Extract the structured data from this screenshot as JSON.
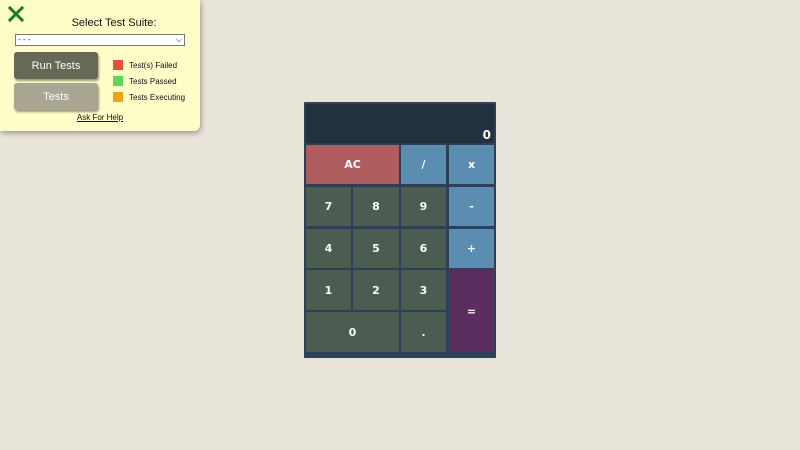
{
  "test_panel": {
    "title": "Select Test Suite:",
    "suite_selected": "- - -",
    "run_button_label": "Run Tests",
    "tests_button_label": "Tests",
    "legend": [
      {
        "label": "Test(s) Failed",
        "color": "#e8503a"
      },
      {
        "label": "Tests Passed",
        "color": "#5fd35a"
      },
      {
        "label": "Tests Executing",
        "color": "#f0a020"
      }
    ],
    "help_link": "Ask For Help",
    "close_icon": "close-x-icon",
    "close_color": "#1d7a1d"
  },
  "calculator": {
    "display_value": "0",
    "keys": {
      "clear": "AC",
      "divide": "/",
      "multiply": "x",
      "subtract": "-",
      "add": "+",
      "equals": "=",
      "decimal": ".",
      "zero": "0",
      "one": "1",
      "two": "2",
      "three": "3",
      "four": "4",
      "five": "5",
      "six": "6",
      "seven": "7",
      "eight": "8",
      "nine": "9"
    }
  }
}
